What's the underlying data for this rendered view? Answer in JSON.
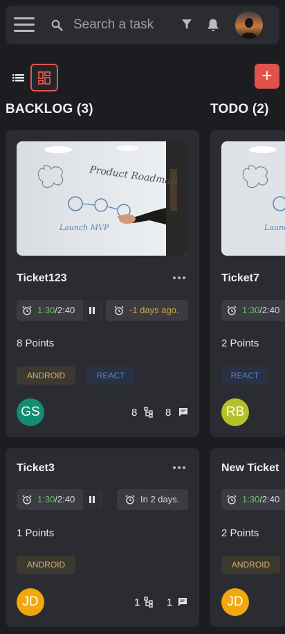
{
  "header": {
    "search_placeholder": "Search a task",
    "icons": [
      "menu-icon",
      "search-icon",
      "filter-icon",
      "bell-icon"
    ]
  },
  "toolbar": {
    "list_view_icon": "list-icon",
    "board_view_icon": "board-icon",
    "add_label": "+"
  },
  "columns": [
    {
      "title": "BACKLOG (3)",
      "cards": [
        {
          "title": "Ticket123",
          "time_spent": "1:30",
          "time_total": "/2:40",
          "due": "-1 days ago.",
          "points": "8 Points",
          "tags": [
            "ANDROID",
            "REACT"
          ],
          "assignee": "GS",
          "subtasks": "8",
          "comments": "8"
        },
        {
          "title": "Ticket3",
          "time_spent": "1:30",
          "time_total": "/2:40",
          "due": "In 2 days.",
          "points": "1 Points",
          "tags": [
            "ANDROID"
          ],
          "assignee": "JD",
          "subtasks": "1",
          "comments": "1"
        }
      ]
    },
    {
      "title": "TODO (2)",
      "cards": [
        {
          "title": "Ticket7",
          "time_spent": "1:30",
          "time_total": "/2:40",
          "points": "2 Points",
          "tags": [
            "REACT"
          ],
          "assignee": "RB"
        },
        {
          "title": "New Ticket",
          "time_spent": "1:30",
          "time_total": "/2:40",
          "points": "2 Points",
          "tags": [
            "ANDROID"
          ],
          "assignee": "JD"
        }
      ]
    }
  ],
  "colors": {
    "accent": "#e0534a",
    "time_green": "#67c05d",
    "overdue": "#d4a74a",
    "avatar_gs": "#128d74",
    "avatar_rb": "#b3c22a",
    "avatar_jd": "#f1a80d"
  }
}
